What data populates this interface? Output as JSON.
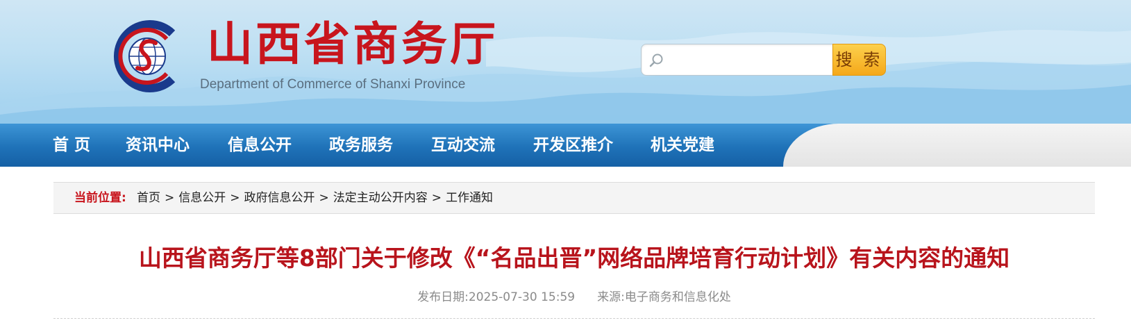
{
  "header": {
    "site_title": "山西省商务厅",
    "site_subtitle": "Department of Commerce of Shanxi Province",
    "logo_icon": "commerce-globe-logo",
    "colors": {
      "title_red": "#c8151d",
      "logo_blue": "#1a3a8c",
      "sky": "#bfe0f3"
    }
  },
  "search": {
    "placeholder": "",
    "value": "",
    "button_label": "搜 索",
    "icon": "search-icon",
    "button_color": "#f5a81a"
  },
  "nav": {
    "items": [
      {
        "label": "首  页"
      },
      {
        "label": "资讯中心"
      },
      {
        "label": "信息公开"
      },
      {
        "label": "政务服务"
      },
      {
        "label": "互动交流"
      },
      {
        "label": "开发区推介"
      },
      {
        "label": "机关党建"
      }
    ],
    "color": "#1f72b8"
  },
  "breadcrumb": {
    "label": "当前位置:",
    "items": [
      "首页",
      "信息公开",
      "政府信息公开",
      "法定主动公开内容",
      "工作通知"
    ],
    "separator": ">"
  },
  "article": {
    "title": "山西省商务厅等8部门关于修改《“名品出晋”网络品牌培育行动计划》有关内容的通知",
    "publish_label": "发布日期:",
    "publish_date": "2025-07-30 15:59",
    "source_label": "来源:",
    "source": "电子商务和信息化处",
    "title_color": "#b8141c"
  }
}
